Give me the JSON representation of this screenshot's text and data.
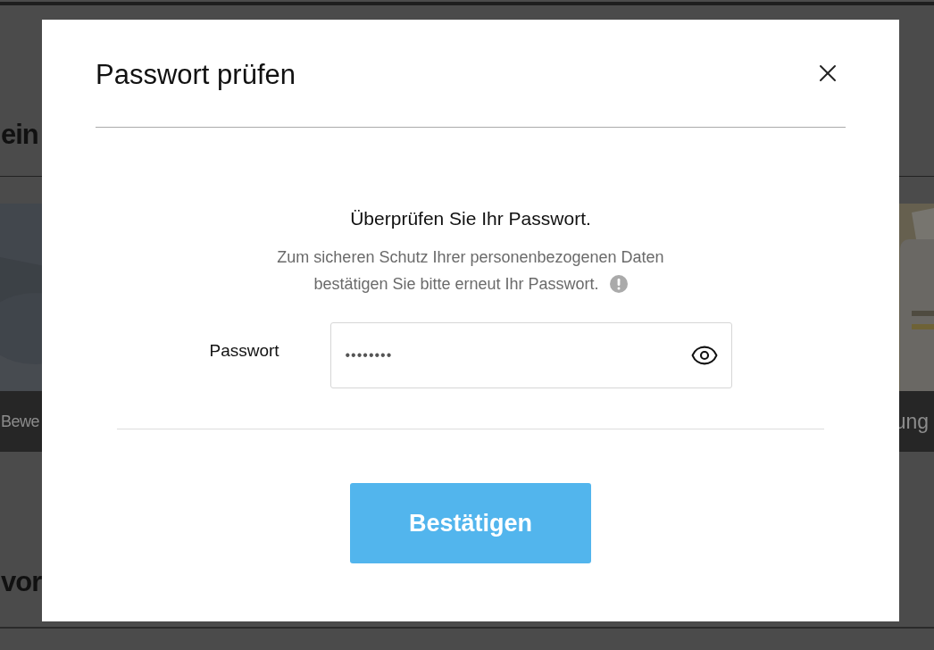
{
  "background": {
    "heading": "ein",
    "banners": [
      {
        "caption": "Bewe"
      },
      {
        "caption": "ung"
      }
    ],
    "section_heading": "vor"
  },
  "dialog": {
    "title": "Passwort prüfen",
    "heading": "Überprüfen Sie Ihr Passwort.",
    "description_lines": [
      "Zum sicheren Schutz Ihrer personenbezogenen Daten",
      "bestätigen Sie bitte erneut Ihr Passwort."
    ],
    "field": {
      "label": "Passwort",
      "value": "••••••••",
      "masked": true
    },
    "button": "Bestätigen"
  }
}
